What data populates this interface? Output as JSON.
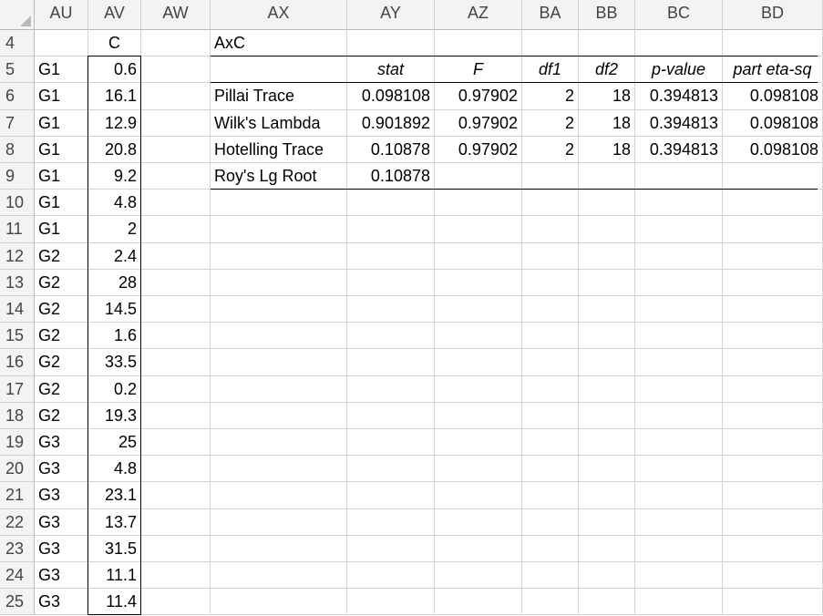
{
  "columns": [
    "AU",
    "AV",
    "AW",
    "AX",
    "AY",
    "AZ",
    "BA",
    "BB",
    "BC",
    "BD"
  ],
  "rows": [
    "4",
    "5",
    "6",
    "7",
    "8",
    "9",
    "10",
    "11",
    "12",
    "13",
    "14",
    "15",
    "16",
    "17",
    "18",
    "19",
    "20",
    "21",
    "22",
    "23",
    "24",
    "25"
  ],
  "data_column": {
    "header": "C",
    "groups": [
      "G1",
      "G1",
      "G1",
      "G1",
      "G1",
      "G1",
      "G1",
      "G2",
      "G2",
      "G2",
      "G2",
      "G2",
      "G2",
      "G2",
      "G3",
      "G3",
      "G3",
      "G3",
      "G3",
      "G3",
      "G3"
    ],
    "values": [
      "0.6",
      "16.1",
      "12.9",
      "20.8",
      "9.2",
      "4.8",
      "2",
      "2.4",
      "28",
      "14.5",
      "1.6",
      "33.5",
      "0.2",
      "19.3",
      "25",
      "4.8",
      "23.1",
      "13.7",
      "31.5",
      "11.1",
      "11.4"
    ]
  },
  "manova_table": {
    "title": "AxC",
    "headers": [
      "stat",
      "F",
      "df1",
      "df2",
      "p-value",
      "part eta-sq"
    ],
    "rows": [
      {
        "label": "Pillai Trace",
        "values": [
          "0.098108",
          "0.97902",
          "2",
          "18",
          "0.394813",
          "0.098108"
        ]
      },
      {
        "label": "Wilk's Lambda",
        "values": [
          "0.901892",
          "0.97902",
          "2",
          "18",
          "0.394813",
          "0.098108"
        ]
      },
      {
        "label": "Hotelling Trace",
        "values": [
          "0.10878",
          "0.97902",
          "2",
          "18",
          "0.394813",
          "0.098108"
        ]
      },
      {
        "label": "Roy's Lg Root",
        "values": [
          "0.10878",
          "",
          "",
          "",
          "",
          ""
        ]
      }
    ]
  }
}
